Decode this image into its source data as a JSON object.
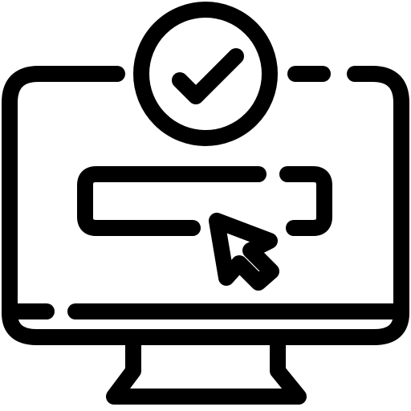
{
  "icon": {
    "name": "monitor-verified-click-icon",
    "stroke_color": "#000000",
    "background_color": "#ffffff",
    "parts": {
      "monitor": "monitor-icon",
      "check": "check-circle-icon",
      "input": "input-field-icon",
      "cursor": "mouse-pointer-icon",
      "stand": "monitor-stand-icon"
    }
  }
}
